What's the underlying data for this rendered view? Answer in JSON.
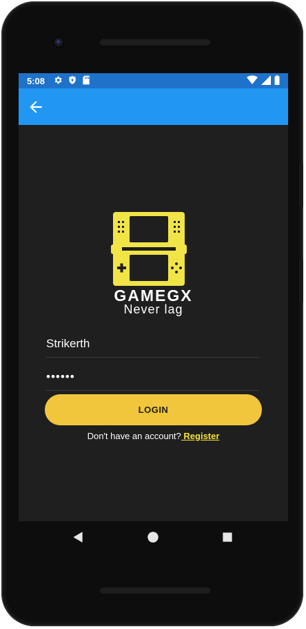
{
  "status_bar": {
    "time": "5:08",
    "left_icons": [
      "gear-icon",
      "play-protect-icon",
      "sd-card-icon"
    ],
    "right_icons": [
      "wifi-icon",
      "signal-icon",
      "battery-icon"
    ],
    "color": "#1f72c9"
  },
  "app_bar": {
    "back_icon": "arrow-back-icon",
    "color": "#2196f3"
  },
  "brand": {
    "name": "GAMEGX",
    "tagline": "Never lag",
    "logo_color": "#f1e447"
  },
  "form": {
    "username": "Strikerth",
    "password": "••••••",
    "login_label": "LOGIN",
    "login_color": "#f1c63c"
  },
  "register": {
    "prompt": "Don't have an account?",
    "link": " Register"
  },
  "nav": {
    "back_icon": "triangle-back-icon",
    "home_icon": "circle-home-icon",
    "recents_icon": "square-recents-icon"
  }
}
